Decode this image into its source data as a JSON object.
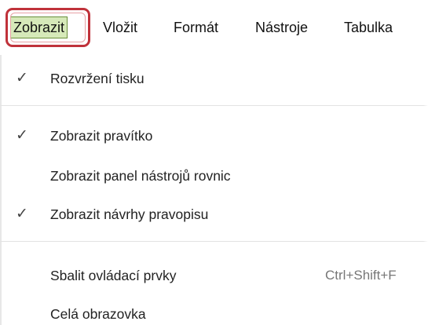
{
  "menubar": {
    "items": [
      {
        "label": "Zobrazit",
        "active": true
      },
      {
        "label": "Vložit"
      },
      {
        "label": "Formát"
      },
      {
        "label": "Nástroje"
      },
      {
        "label": "Tabulka"
      }
    ]
  },
  "dropdown": {
    "items": [
      {
        "label": "Rozvržení tisku",
        "checked": true,
        "check_icon": "checkmark-icon"
      },
      {
        "label": "Zobrazit pravítko",
        "checked": true,
        "check_icon": "checkmark-icon"
      },
      {
        "label": "Zobrazit panel nástrojů rovnic",
        "checked": false
      },
      {
        "label": "Zobrazit návrhy pravopisu",
        "checked": true,
        "check_icon": "checkmark-icon"
      },
      {
        "label": "Sbalit ovládací prvky",
        "shortcut": "Ctrl+Shift+F",
        "checked": false
      },
      {
        "label": "Celá obrazovka",
        "checked": false
      }
    ]
  },
  "colors": {
    "active_bg": "#d6e9b9",
    "active_border": "#6a8f3b",
    "highlight_ring": "#c0323a"
  }
}
